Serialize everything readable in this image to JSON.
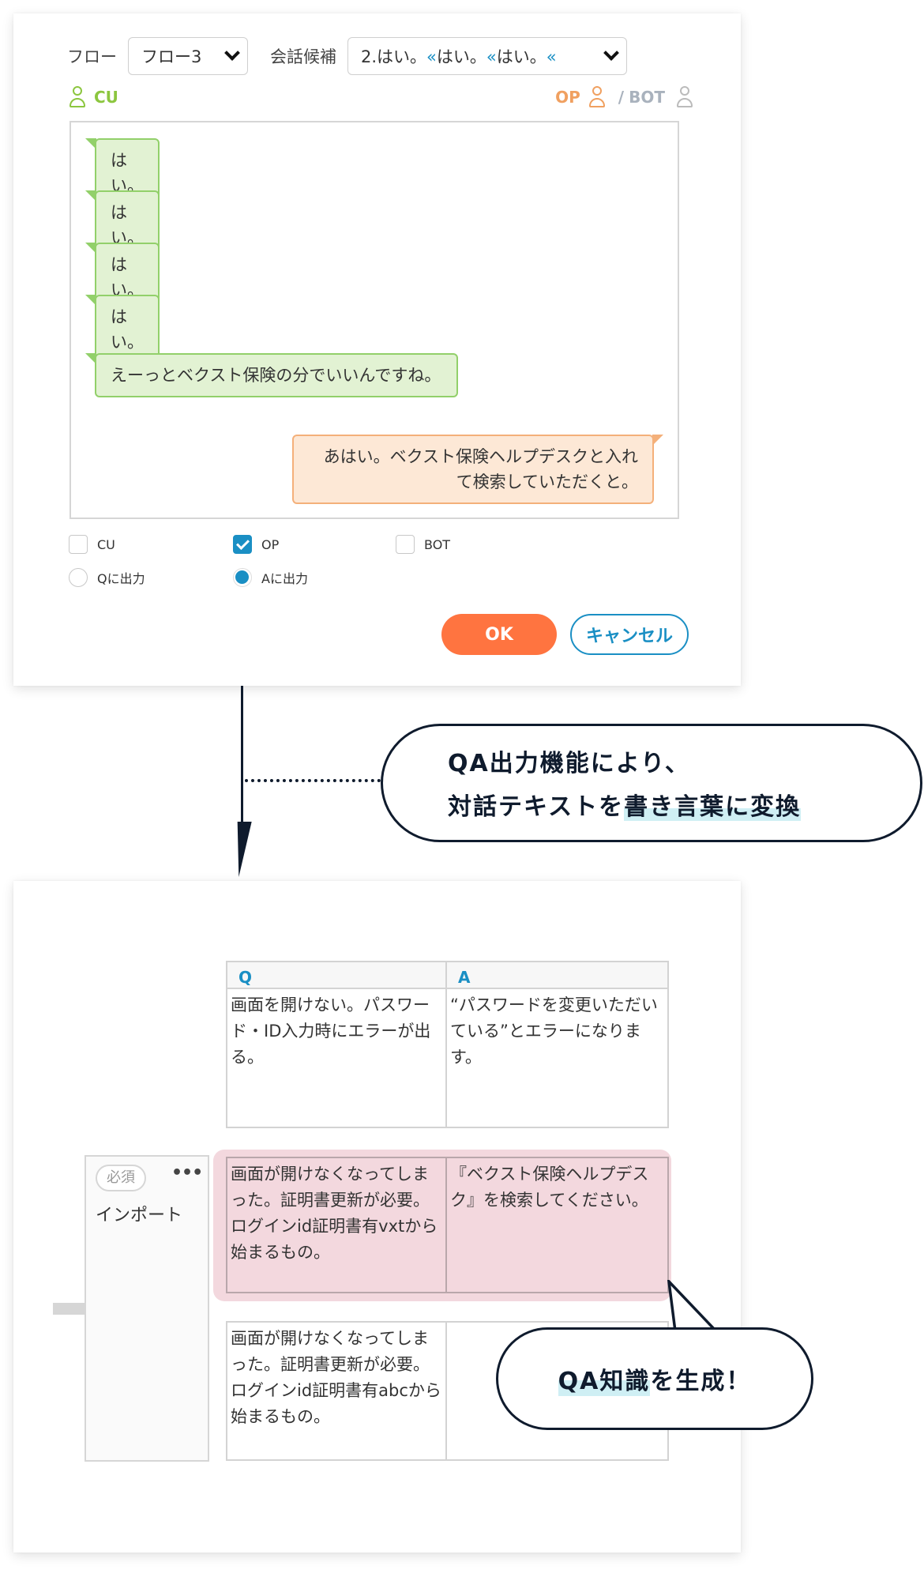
{
  "dialog": {
    "flow_label": "フロー",
    "flow_value": "フロー3",
    "candidate_label": "会話候補",
    "candidate_value_text": "2.はい。",
    "candidate_value_parts": [
      "はい。",
      "はい。",
      ""
    ],
    "candidate_value_full": "2.はい。«はい。«はい。«",
    "speakers": {
      "cu": "CU",
      "op": "OP",
      "slash": "/",
      "bot": "BOT"
    },
    "messages": [
      {
        "speaker": "CU",
        "text": "はい。"
      },
      {
        "speaker": "CU",
        "text": "はい。"
      },
      {
        "speaker": "CU",
        "text": "はい。"
      },
      {
        "speaker": "CU",
        "text": "はい。"
      },
      {
        "speaker": "CU",
        "text": "えーっとベクスト保険の分でいいんですね。"
      },
      {
        "speaker": "OP",
        "text": "あはい。ベクスト保険ヘルプデスクと入れて検索していただくと。"
      }
    ],
    "checkboxes": [
      {
        "label": "CU",
        "checked": false
      },
      {
        "label": "OP",
        "checked": true
      },
      {
        "label": "BOT",
        "checked": false
      }
    ],
    "radios": [
      {
        "label": "Qに出力",
        "selected": false
      },
      {
        "label": "Aに出力",
        "selected": true
      }
    ],
    "ok_label": "OK",
    "cancel_label": "キャンセル"
  },
  "callout_1": {
    "line1": "QA出力機能により、",
    "line2_plain": "対話テキストを",
    "line2_highlight": "書き言葉に変換"
  },
  "qa_table": {
    "headers": [
      "Q",
      "A"
    ],
    "rows": [
      {
        "q": "画面を開けない。パスワード・ID入力時にエラーが出る。",
        "a": "“パスワードを変更いただいている”とエラーになります。",
        "highlighted": false
      },
      {
        "q": "画面が開けなくなってしまった。証明書更新が必要。ログインid証明書有vxtから始まるもの。",
        "a": "『ベクスト保険ヘルプデスク』を検索してください。",
        "highlighted": true
      },
      {
        "q": "画面が開けなくなってしまった。証明書更新が必要。ログインid証明書有abcから始まるもの。",
        "a": "",
        "highlighted": false
      }
    ]
  },
  "import_card": {
    "badge": "必須",
    "more": "•••",
    "label": "インポート"
  },
  "callout_2": {
    "highlight": "QA知識",
    "plain": "を生成！"
  },
  "colors": {
    "cu_green": "#8cc63f",
    "op_orange": "#f0a060",
    "accent_blue": "#1a8fc4",
    "ok_orange": "#ff7440",
    "highlight_pink": "#f3d8de",
    "callout_navy": "#0f1b2d",
    "marker_cyan": "#cfeff4"
  }
}
